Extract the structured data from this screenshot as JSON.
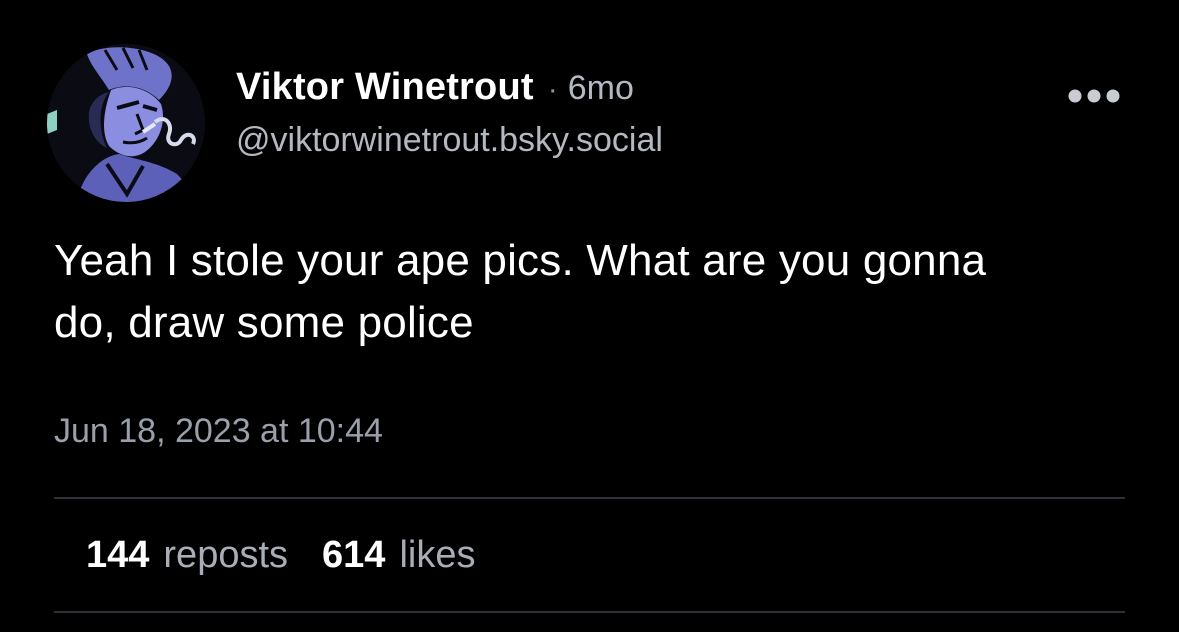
{
  "post": {
    "author": {
      "display_name": "Viktor Winetrout",
      "separator": "·",
      "time_ago": "6mo",
      "handle": "@viktorwinetrout.bsky.social",
      "avatar_icon": "avatar-portrait-icon"
    },
    "more_icon": "more-options-icon",
    "text_line_1": "Yeah I stole your ape pics. What are you gonna",
    "text_line_2": "do, draw some police",
    "timestamp": "Jun 18, 2023 at 10:44",
    "stats": {
      "reposts_count": "144",
      "reposts_label": "reposts",
      "likes_count": "614",
      "likes_label": "likes"
    }
  },
  "colors": {
    "background": "#000000",
    "primary_text": "#ffffff",
    "secondary_text": "#b4b8c0",
    "avatar_tint": "#7d7fd6",
    "divider": "#2e3138"
  }
}
